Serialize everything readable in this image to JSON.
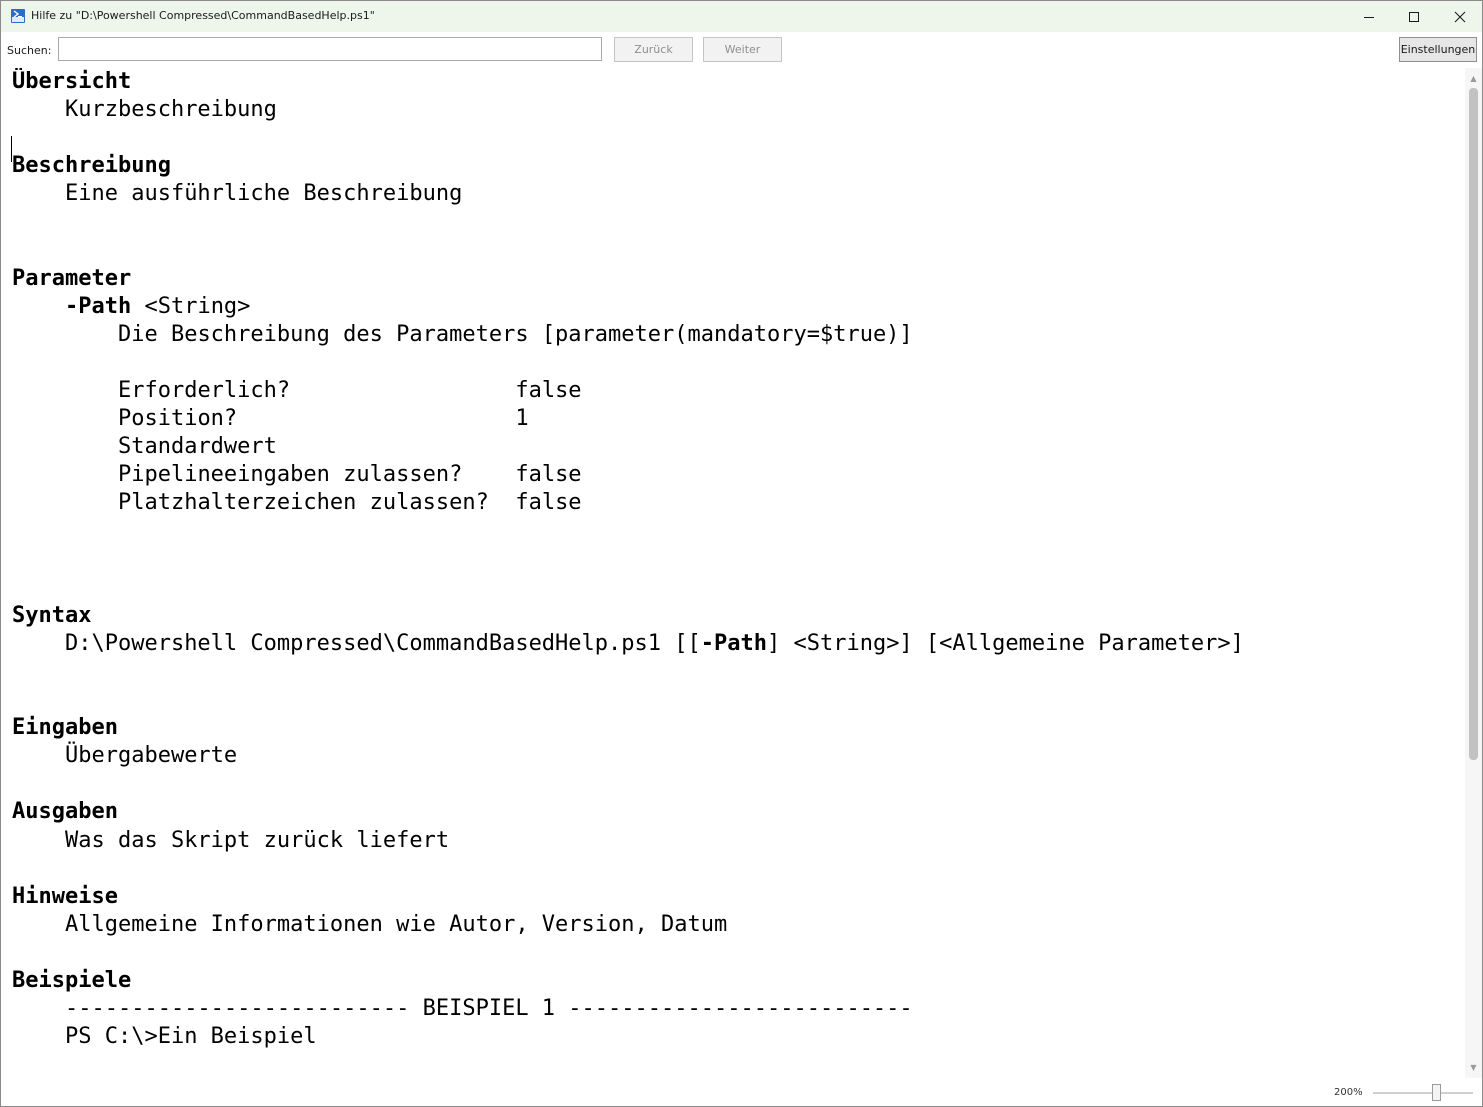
{
  "window": {
    "title": "Hilfe zu \"D:\\Powershell Compressed\\CommandBasedHelp.ps1\"",
    "icon": "powershell-icon",
    "controls": {
      "minimize": "minimize-icon",
      "maximize": "maximize-icon",
      "close": "close-icon"
    }
  },
  "toolbar": {
    "search_label": "Suchen:",
    "search_value": "",
    "back_label": "Zurück",
    "next_label": "Weiter",
    "settings_label": "Einstellungen"
  },
  "help": {
    "overview_heading": "Übersicht",
    "overview_text": "Kurzbeschreibung",
    "description_heading": "Beschreibung",
    "description_text": "Eine ausführliche Beschreibung",
    "parameters_heading": "Parameter",
    "param_name": "-Path",
    "param_type": " <String>",
    "param_description": "Die Beschreibung des Parameters [parameter(mandatory=$true)]",
    "param_props": [
      {
        "label": "Erforderlich?                 ",
        "value": "false"
      },
      {
        "label": "Position?                     ",
        "value": "1"
      },
      {
        "label": "Standardwert",
        "value": ""
      },
      {
        "label": "Pipelineeingaben zulassen?    ",
        "value": "false"
      },
      {
        "label": "Platzhalterzeichen zulassen?  ",
        "value": "false"
      }
    ],
    "syntax_heading": "Syntax",
    "syntax_prefix": "D:\\Powershell Compressed\\CommandBasedHelp.ps1 [[",
    "syntax_param": "-Path",
    "syntax_suffix": "] <String>] [<Allgemeine Parameter>]",
    "inputs_heading": "Eingaben",
    "inputs_text": "Übergabewerte",
    "outputs_heading": "Ausgaben",
    "outputs_text": "Was das Skript zurück liefert",
    "notes_heading": "Hinweise",
    "notes_text": "Allgemeine Informationen wie Autor, Version, Datum",
    "examples_heading": "Beispiele",
    "example_title": "-------------------------- BEISPIEL 1 --------------------------",
    "example_code": "PS C:\\>Ein Beispiel"
  },
  "statusbar": {
    "zoom": "200%"
  }
}
